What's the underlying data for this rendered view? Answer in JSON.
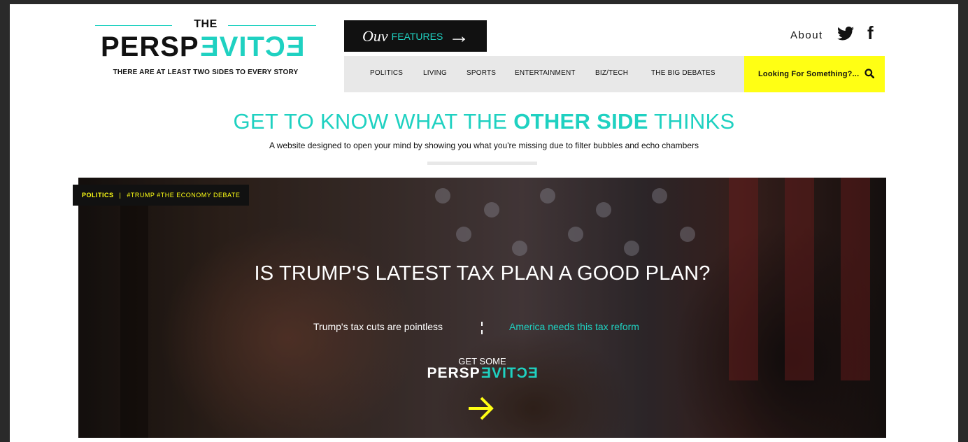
{
  "logo": {
    "the": "THE",
    "word_start": "PERSP",
    "word_mirrored": "ECTIVE",
    "tagline": "THERE ARE AT LEAST TWO SIDES TO EVERY STORY"
  },
  "features_button": {
    "prefix": "Ouv",
    "label": "FEATURES",
    "arrow": "→"
  },
  "header": {
    "about": "About",
    "social_icons": [
      "twitter-icon",
      "facebook-icon"
    ]
  },
  "nav": {
    "items": [
      "POLITICS",
      "LIVING",
      "SPORTS",
      "ENTERTAINMENT",
      "BIZ/TECH",
      "THE BIG DEBATES"
    ]
  },
  "search": {
    "label": "Looking For Something?...",
    "icon": "search-icon"
  },
  "headline": {
    "pre": "GET TO KNOW WHAT THE ",
    "bold": "OTHER SIDE",
    "post": " THINKS",
    "subtitle": "A website designed to open your mind by showing you what you're missing due to filter bubbles and echo chambers"
  },
  "hero": {
    "category": "POLITICS",
    "separator": "|",
    "tags": "#TRUMP #THE ECONOMY DEBATE",
    "question": "IS TRUMP'S LATEST TAX PLAN A GOOD PLAN?",
    "left_side": "Trump's tax cuts are pointless",
    "right_side": "America needs this tax reform",
    "cta_top": "GET SOME",
    "cta_word_start": "PERSP",
    "cta_word_mirrored": "ECTIVE",
    "cta_arrow": "go-arrow-icon"
  },
  "colors": {
    "accent_teal": "#1fd1c1",
    "accent_yellow": "#ffff14",
    "dark": "#111111",
    "nav_bg": "#e8e8e8"
  }
}
